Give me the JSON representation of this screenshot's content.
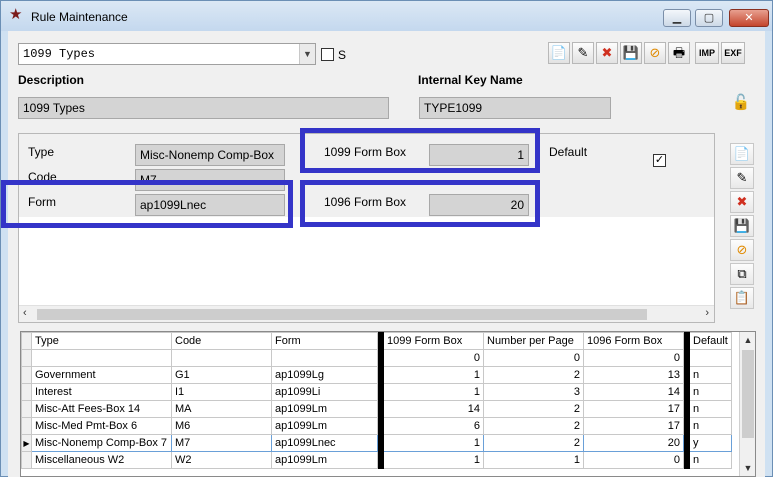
{
  "window": {
    "title": "Rule Maintenance",
    "minimize": "▁",
    "maximize": "▢",
    "close": "✕"
  },
  "selector": {
    "value": "1099 Types",
    "s_label": "S"
  },
  "toolbar": {
    "imp_label": "IMP",
    "exp_label": "EXF"
  },
  "header": {
    "description_label": "Description",
    "description_value": "1099 Types",
    "key_label": "Internal Key Name",
    "key_value": "TYPE1099"
  },
  "detail": {
    "type_label": "Type",
    "type_value": "Misc-Nonemp Comp-Box",
    "code_label": "Code",
    "code_value": "M7",
    "form_label": "Form",
    "form_value": "ap1099Lnec",
    "box1099_label": "1099 Form Box",
    "box1099_value": "1",
    "box1096_label": "1096 Form Box",
    "box1096_value": "20",
    "default_label": "Default",
    "default_checked": true
  },
  "grid": {
    "columns": [
      "Type",
      "Code",
      "Form",
      "1099 Form Box",
      "Number per Page",
      "1096 Form Box",
      "Default"
    ],
    "rows": [
      [
        "",
        "",
        "",
        "0",
        "0",
        "0",
        ""
      ],
      [
        "Government",
        "G1",
        "ap1099Lg",
        "1",
        "2",
        "13",
        "n"
      ],
      [
        "Interest",
        "I1",
        "ap1099Li",
        "1",
        "3",
        "14",
        "n"
      ],
      [
        "Misc-Att Fees-Box 14",
        "MA",
        "ap1099Lm",
        "14",
        "2",
        "17",
        "n"
      ],
      [
        "Misc-Med Pmt-Box 6",
        "M6",
        "ap1099Lm",
        "6",
        "2",
        "17",
        "n"
      ],
      [
        "Misc-Nonemp Comp-Box 7",
        "M7",
        "ap1099Lnec",
        "1",
        "2",
        "20",
        "y"
      ],
      [
        "Miscellaneous W2",
        "W2",
        "ap1099Lm",
        "1",
        "1",
        "0",
        "n"
      ]
    ],
    "selected_row": 5
  },
  "colors": {
    "highlight": "#3434c8",
    "accent": "#cfe1f2"
  }
}
